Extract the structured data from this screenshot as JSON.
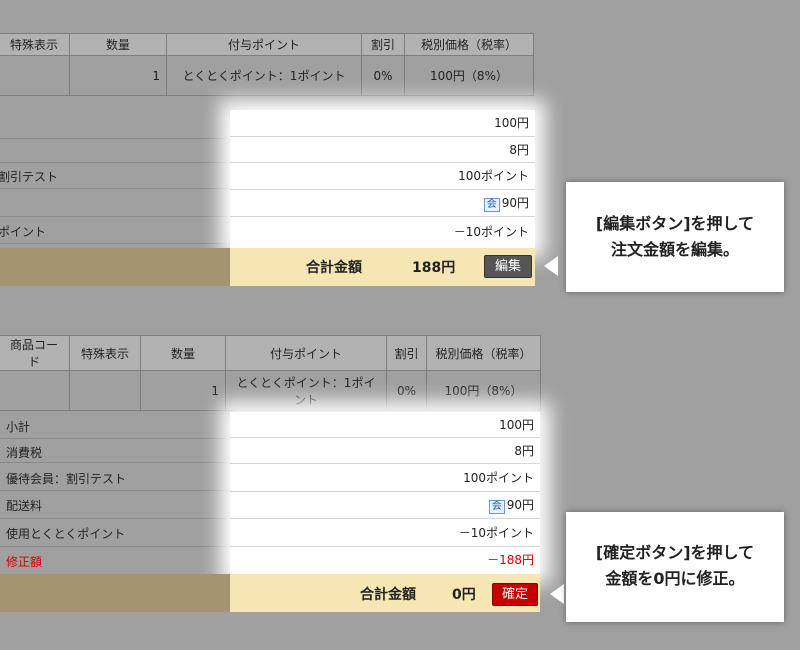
{
  "screen1": {
    "headers": [
      "特殊表示",
      "数量",
      "付与ポイント",
      "割引",
      "税別価格（税率）"
    ],
    "row": [
      "",
      "1",
      "とくとくポイント：1ポイント",
      "0%",
      "100円（8%）"
    ],
    "summary_labels": [
      "",
      "",
      "割引テスト",
      "",
      "ポイント"
    ],
    "summary_values": [
      "100円",
      "8円",
      "100ポイント",
      "90円",
      "－10ポイント"
    ],
    "member_badge": "会",
    "total_label": "合計金額",
    "total_value": "188円",
    "edit_button": "編集"
  },
  "screen2": {
    "headers": [
      "商品コード",
      "特殊表示",
      "数量",
      "付与ポイント",
      "割引",
      "税別価格（税率）"
    ],
    "row": [
      "",
      "",
      "1",
      "とくとくポイント：1ポイント",
      "0%",
      "100円（8%）"
    ],
    "summary_labels": [
      "小計",
      "消費税",
      "優待会員：割引テスト",
      "配送料",
      "使用とくとくポイント",
      "修正額"
    ],
    "summary_values": [
      "100円",
      "8円",
      "100ポイント",
      "90円",
      "－10ポイント",
      "－188円"
    ],
    "member_badge": "会",
    "total_label": "合計金額",
    "total_value": "0円",
    "confirm_button": "確定"
  },
  "callout1": {
    "line1": "[編集ボタン]を押して",
    "line2": "注文金額を編集。"
  },
  "callout2": {
    "line1": "[確定ボタン]を押して",
    "line2": "金額を0円に修正。"
  }
}
